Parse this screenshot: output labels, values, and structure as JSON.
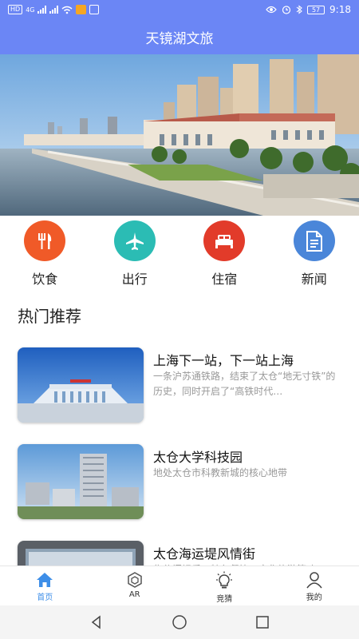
{
  "status": {
    "left_chips": [
      "HD",
      "4G"
    ],
    "time": "9:18",
    "battery": "57"
  },
  "app": {
    "title": "天镜湖文旅"
  },
  "categories": [
    {
      "label": "饮食",
      "icon": "utensils-icon",
      "color": "#f05a28"
    },
    {
      "label": "出行",
      "icon": "airplane-icon",
      "color": "#2bbcb4"
    },
    {
      "label": "住宿",
      "icon": "bed-icon",
      "color": "#e23b2a"
    },
    {
      "label": "新闻",
      "icon": "document-icon",
      "color": "#4a86d9"
    }
  ],
  "section": {
    "title": "热门推荐"
  },
  "recommendations": [
    {
      "title": "上海下一站，下一站上海",
      "desc": "一条沪苏通铁路，结束了太仓“地无寸铁”的历史，同时开启了“高铁时代…"
    },
    {
      "title": "太仓大学科技园",
      "desc": "地处太仓市科教新城的核心地带"
    },
    {
      "title": "太仓海运堤风情街",
      "desc": "集休闲娱乐，特色餐饮，文化旅游等功"
    }
  ],
  "tabs": [
    {
      "label": "首页",
      "icon": "home-icon",
      "active": true
    },
    {
      "label": "AR",
      "icon": "ar-hexagon-icon",
      "active": false
    },
    {
      "label": "竞猜",
      "icon": "lightbulb-icon",
      "active": false
    },
    {
      "label": "我的",
      "icon": "person-icon",
      "active": false
    }
  ],
  "colors": {
    "primary": "#6b86f5",
    "tab_active": "#3d8ee8"
  }
}
